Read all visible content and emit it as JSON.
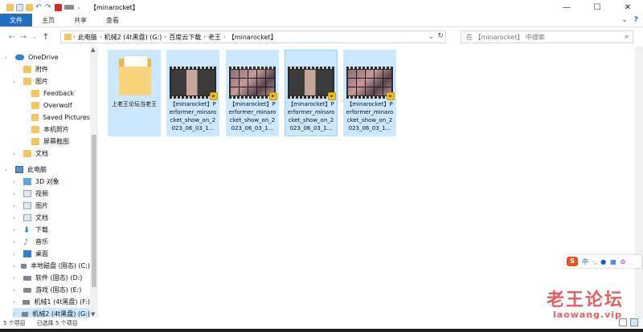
{
  "window": {
    "title": "【minarocket】",
    "controls": {
      "minimize": "—",
      "maximize": "☐",
      "close": "✕"
    }
  },
  "ribbon": {
    "tabs": [
      "文件",
      "主页",
      "共享",
      "查看"
    ],
    "expand_icon": "chevron-down-icon",
    "help_icon": "help-icon"
  },
  "address": {
    "back": "←",
    "forward": "→",
    "recent": "⌄",
    "up": "↑",
    "crumbs": [
      "此电脑",
      "机械2 (4t黑盘) (G:)",
      "百度云下载",
      "老王",
      "【minarocket】"
    ],
    "search_placeholder": "在 【minarocket】 中搜索"
  },
  "sidebar": {
    "items": [
      {
        "label": "OneDrive",
        "icon": "cloud",
        "indent": 0,
        "expander": "›"
      },
      {
        "label": "附件",
        "icon": "folder",
        "indent": 1
      },
      {
        "label": "图片",
        "icon": "folder",
        "indent": 1,
        "expander": "›"
      },
      {
        "label": "Feedback",
        "icon": "folder",
        "indent": 2
      },
      {
        "label": "Overwolf",
        "icon": "folder",
        "indent": 2
      },
      {
        "label": "Saved Pictures",
        "icon": "folder",
        "indent": 2
      },
      {
        "label": "本机照片",
        "icon": "folder",
        "indent": 2
      },
      {
        "label": "屏幕截图",
        "icon": "folder",
        "indent": 2
      },
      {
        "label": "文档",
        "icon": "folder",
        "indent": 1,
        "expander": "›"
      },
      {
        "label": "此电脑",
        "icon": "pc",
        "indent": 0,
        "expander": "›"
      },
      {
        "label": "3D 对象",
        "icon": "cube",
        "indent": 1,
        "expander": "›"
      },
      {
        "label": "视频",
        "icon": "doc",
        "indent": 1,
        "expander": "›"
      },
      {
        "label": "图片",
        "icon": "doc",
        "indent": 1,
        "expander": "›"
      },
      {
        "label": "文档",
        "icon": "doc",
        "indent": 1,
        "expander": "›"
      },
      {
        "label": "下载",
        "icon": "down",
        "indent": 1,
        "expander": "›"
      },
      {
        "label": "音乐",
        "icon": "music",
        "indent": 1,
        "expander": "›"
      },
      {
        "label": "桌面",
        "icon": "desk",
        "indent": 1,
        "expander": "›"
      },
      {
        "label": "本地磁盘 (固态) (C:)",
        "icon": "drive",
        "indent": 1,
        "expander": "›"
      },
      {
        "label": "软件 (固态) (D:)",
        "icon": "drive",
        "indent": 1,
        "expander": "›"
      },
      {
        "label": "游戏 (固态) (E:)",
        "icon": "drive",
        "indent": 1,
        "expander": "›"
      },
      {
        "label": "机械1 (4t黑盘) (F:)",
        "icon": "drive",
        "indent": 1,
        "expander": "›"
      },
      {
        "label": "机械2 (4t黑盘) (G:)",
        "icon": "drive",
        "indent": 1,
        "expander": "›",
        "selected": true
      }
    ]
  },
  "files": [
    {
      "type": "folder",
      "label": "上老王论坛当老王"
    },
    {
      "type": "video",
      "thumb": "single",
      "label": "【minarocket】Performer_minarocket_show_on_2023_06_03_1..."
    },
    {
      "type": "video",
      "thumb": "grid",
      "label": "【minarocket】Performer_minarocket_show_on_2023_06_03_1..."
    },
    {
      "type": "video",
      "thumb": "single",
      "label": "【minarocket】Performer_minarocket_show_on_2023_06_03_1...",
      "focused": true
    },
    {
      "type": "video",
      "thumb": "grid",
      "label": "【minarocket】Performer_minarocket_show_on_2023_06_03_1..."
    }
  ],
  "status": {
    "count": "5 个项目",
    "selected": "已选择 5 个项目"
  },
  "ime": {
    "logo": "S",
    "mode": "中",
    "punct": "·,"
  },
  "watermark": {
    "line1": "老王论坛",
    "line2": "laowang.vip"
  },
  "colors": {
    "accent": "#1f6fc3",
    "selection": "#cce8ff",
    "folder": "#f4c55c",
    "watermark": "#dc2828"
  }
}
